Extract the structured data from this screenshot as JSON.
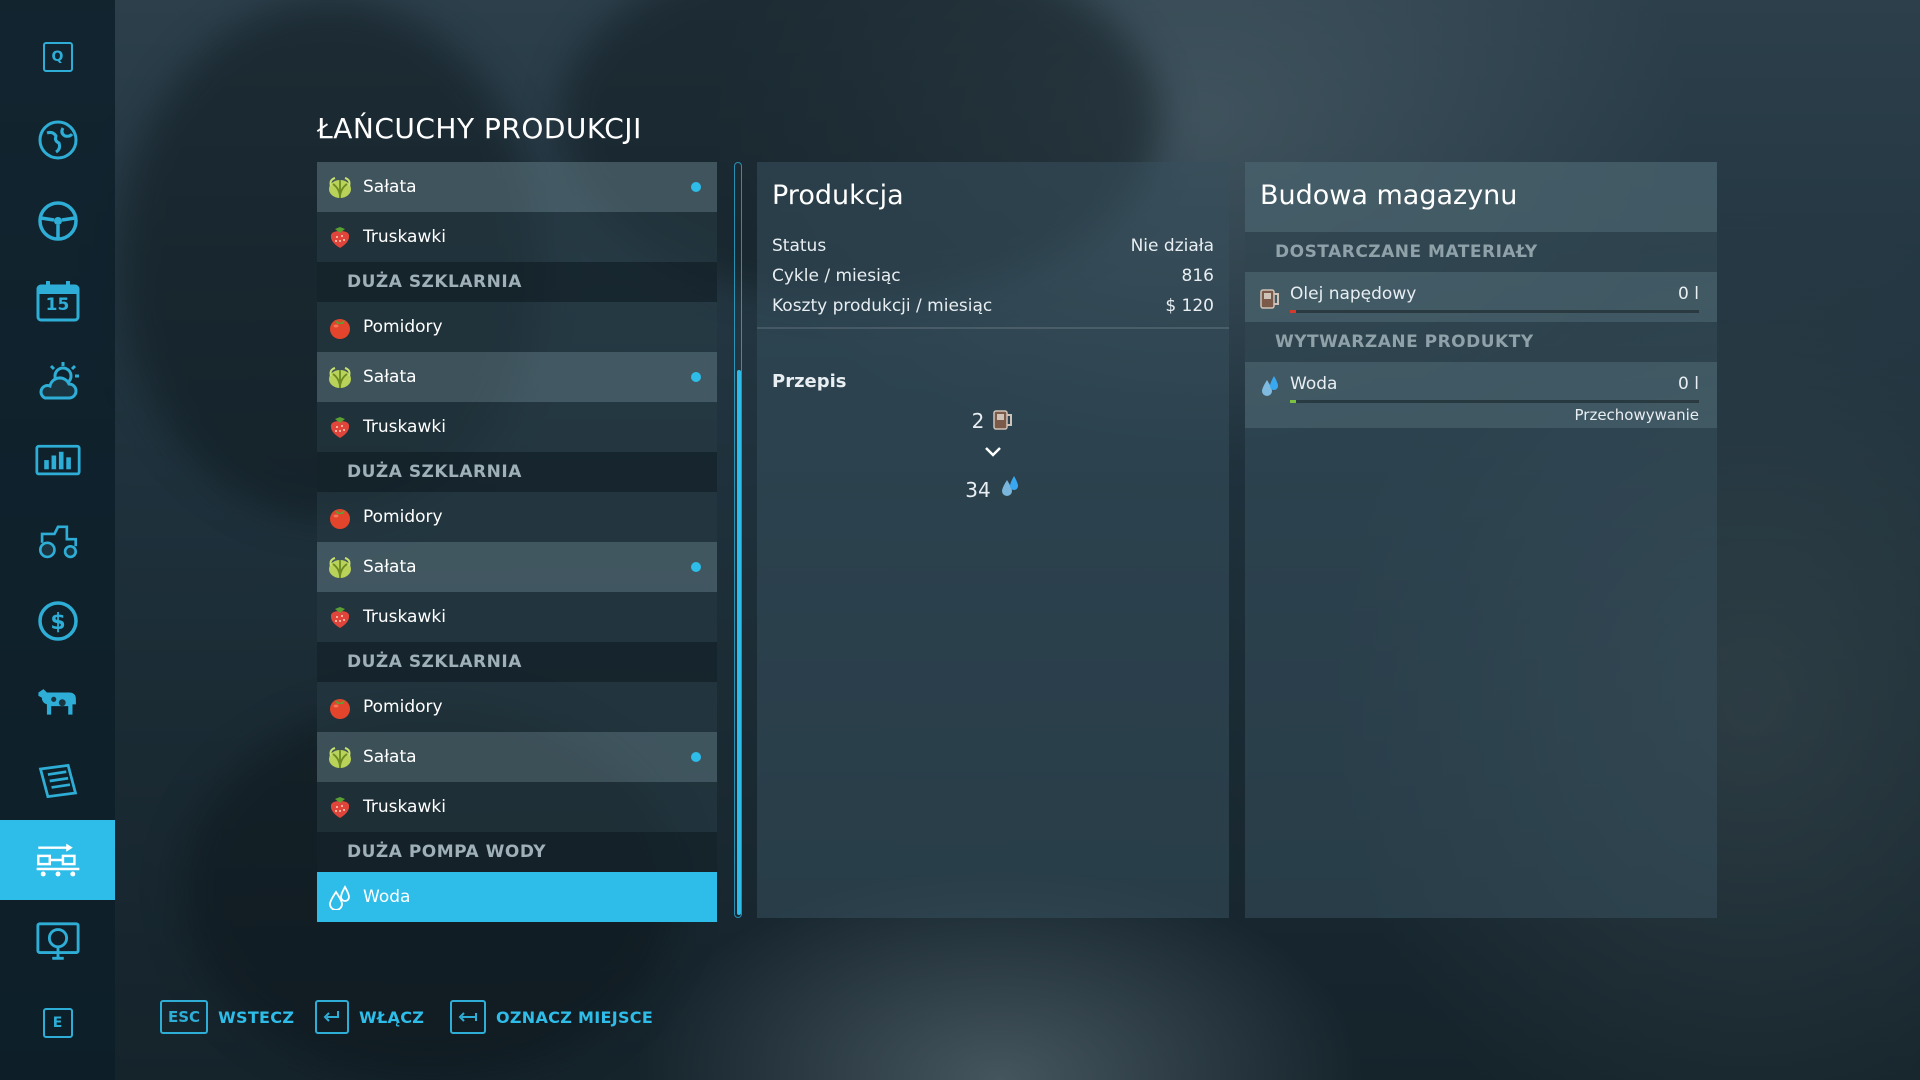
{
  "page": {
    "title": "ŁAŃCUCHY PRODUKCJI"
  },
  "sidebar": {
    "top_key": "Q",
    "bottom_key": "E",
    "items": [
      {
        "icon": "globe-map-icon"
      },
      {
        "icon": "steering-wheel-icon"
      },
      {
        "icon": "calendar-icon",
        "calendar_day": "15"
      },
      {
        "icon": "weather-icon"
      },
      {
        "icon": "statistics-icon"
      },
      {
        "icon": "tractor-icon"
      },
      {
        "icon": "finances-icon"
      },
      {
        "icon": "animals-icon"
      },
      {
        "icon": "contracts-icon"
      },
      {
        "icon": "production-chains-icon",
        "active": true
      },
      {
        "icon": "help-icon"
      }
    ]
  },
  "production_list": {
    "rows": [
      {
        "type": "item",
        "label": "Sałata",
        "icon": "lettuce",
        "shade": "light",
        "dot": true
      },
      {
        "type": "item",
        "label": "Truskawki",
        "icon": "strawberry",
        "shade": "dark"
      },
      {
        "type": "header",
        "label": "DUŻA SZKLARNIA"
      },
      {
        "type": "item",
        "label": "Pomidory",
        "icon": "tomato",
        "shade": "dark"
      },
      {
        "type": "item",
        "label": "Sałata",
        "icon": "lettuce",
        "shade": "light",
        "dot": true
      },
      {
        "type": "item",
        "label": "Truskawki",
        "icon": "strawberry",
        "shade": "dark"
      },
      {
        "type": "header",
        "label": "DUŻA SZKLARNIA"
      },
      {
        "type": "item",
        "label": "Pomidory",
        "icon": "tomato",
        "shade": "dark"
      },
      {
        "type": "item",
        "label": "Sałata",
        "icon": "lettuce",
        "shade": "light",
        "dot": true
      },
      {
        "type": "item",
        "label": "Truskawki",
        "icon": "strawberry",
        "shade": "dark"
      },
      {
        "type": "header",
        "label": "DUŻA SZKLARNIA"
      },
      {
        "type": "item",
        "label": "Pomidory",
        "icon": "tomato",
        "shade": "dark"
      },
      {
        "type": "item",
        "label": "Sałata",
        "icon": "lettuce",
        "shade": "light",
        "dot": true
      },
      {
        "type": "item",
        "label": "Truskawki",
        "icon": "strawberry",
        "shade": "dark"
      },
      {
        "type": "header",
        "label": "DUŻA POMPA WODY"
      },
      {
        "type": "item",
        "label": "Woda",
        "icon": "water",
        "shade": "selected"
      }
    ]
  },
  "production": {
    "title": "Produkcja",
    "status_label": "Status",
    "status_value": "Nie działa",
    "cycles_label": "Cykle / miesiąc",
    "cycles_value": "816",
    "costs_label": "Koszty produkcji / miesiąc",
    "costs_value": "$ 120",
    "recipe_title": "Przepis",
    "recipe_input_amount": "2",
    "recipe_output_amount": "34"
  },
  "storage_build": {
    "title": "Budowa magazynu",
    "inputs_header": "DOSTARCZANE MATERIAŁY",
    "input_name": "Olej napędowy",
    "input_amount": "0 l",
    "input_fill": 0,
    "outputs_header": "WYTWARZANE PRODUKTY",
    "output_name": "Woda",
    "output_amount": "0 l",
    "output_fill": 0,
    "output_mode": "Przechowywanie"
  },
  "footer": {
    "back_key": "ESC",
    "back_label": "WSTECZ",
    "toggle_label": "WŁĄCZ",
    "mark_label": "OZNACZ MIEJSCE"
  },
  "colors": {
    "accent": "#2ebde9",
    "input_bar": "#d33a2c",
    "output_bar": "#7cc242"
  }
}
